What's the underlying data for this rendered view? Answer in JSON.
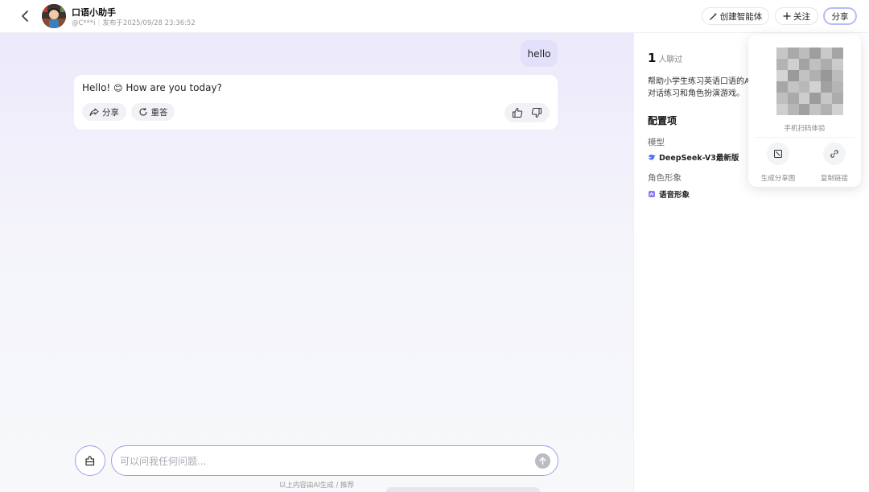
{
  "header": {
    "agent_name": "口语小助手",
    "author": "@C***i",
    "published": "发布于2025/09/28 23:36:52",
    "create_label": "创建智能体",
    "follow_label": "关注",
    "share_label": "分享"
  },
  "chat": {
    "user_message": "hello",
    "bot_message_prefix": "Hello!",
    "bot_emoji": "😊",
    "bot_message_suffix": "How are you today?",
    "share_chip_label": "分享",
    "regenerate_chip_label": "重答",
    "input_placeholder": "可以问我任何问题...",
    "disclaimer": "以上内容由AI生成 / 推荐"
  },
  "side": {
    "chat_count": "1",
    "chat_count_label": "人聊过",
    "description_line1": "帮助小学生练习英语口语的A",
    "description_line2": "对话练习和角色扮演游戏。",
    "config_title": "配置项",
    "model_label": "模型",
    "model_value": "DeepSeek-V3最新版",
    "persona_label": "角色形象",
    "persona_value": "语音形象"
  },
  "share_popover": {
    "qr_caption": "手机扫码体验",
    "generate_image_label": "生成分享图",
    "copy_link_label": "复制链接"
  },
  "colors": {
    "accent": "#a69cf0",
    "user_bubble": "#e2e0fb",
    "model_icon": "#4d6bfe",
    "persona_icon": "#8b7cf6"
  }
}
